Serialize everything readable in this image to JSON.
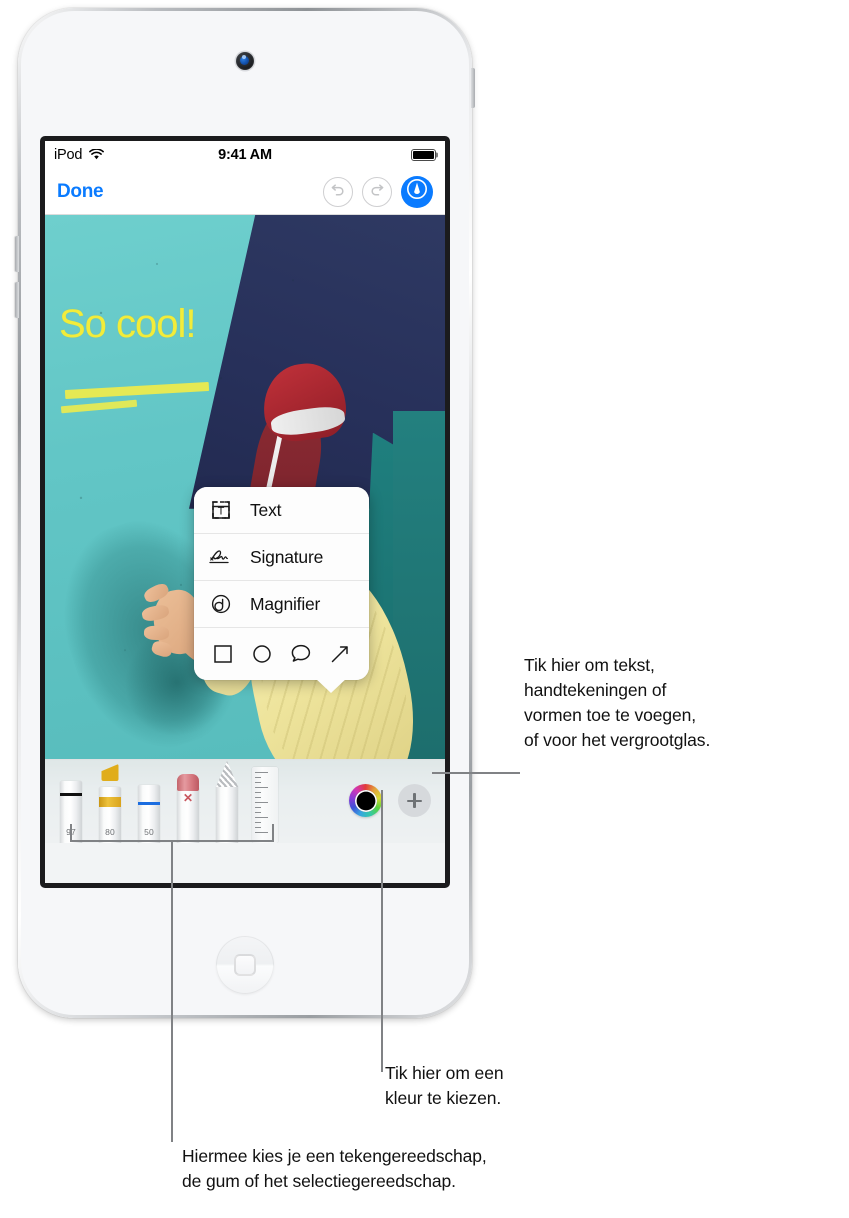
{
  "device": {
    "name": "iPod touch",
    "frame_color": "#f2f3f5"
  },
  "status_bar": {
    "carrier": "iPod",
    "wifi_icon": "wifi-icon",
    "time": "9:41 AM",
    "battery_icon": "battery-full-icon"
  },
  "nav_bar": {
    "done_label": "Done",
    "undo_icon": "undo-icon",
    "undo_enabled": false,
    "redo_icon": "redo-icon",
    "redo_enabled": false,
    "markup_icon": "markup-pen-icon",
    "markup_active": true,
    "accent_color": "#0a7bff"
  },
  "photo": {
    "annotation_text": "So cool!",
    "annotation_color": "#f2ec3a",
    "highlight_color": "#f0ec4a",
    "description": "Breakdancer in mid-move against teal and navy wall"
  },
  "popup_menu": {
    "items": [
      {
        "icon": "text-box-icon",
        "label": "Text"
      },
      {
        "icon": "signature-icon",
        "label": "Signature"
      },
      {
        "icon": "magnifier-icon",
        "label": "Magnifier"
      }
    ],
    "shapes": [
      {
        "icon": "square-shape-icon"
      },
      {
        "icon": "circle-shape-icon"
      },
      {
        "icon": "speech-bubble-shape-icon"
      },
      {
        "icon": "arrow-shape-icon"
      }
    ]
  },
  "toolbar": {
    "tools": [
      {
        "name": "pen-tool",
        "number": "97",
        "color": "#0f0f0f"
      },
      {
        "name": "highlighter-tool",
        "number": "80",
        "color": "#e0ad1b"
      },
      {
        "name": "pencil-tool",
        "number": "50",
        "color": "#1b6de0"
      },
      {
        "name": "eraser-tool",
        "number": "",
        "color": "#c8565e",
        "badge": "✕"
      },
      {
        "name": "lasso-tool",
        "number": "",
        "color": "#b9bcbf"
      },
      {
        "name": "ruler-tool",
        "number": "",
        "color": "#eceef0"
      }
    ],
    "color_picker": {
      "name": "color-wheel",
      "selected_color": "#000000"
    },
    "add_button": {
      "name": "add-annotation-button",
      "icon": "plus-icon"
    }
  },
  "callouts": [
    {
      "id": "callout-add",
      "lines": [
        "Tik hier om tekst,",
        "handtekeningen of",
        "vormen toe te voegen,",
        "of voor het vergrootglas."
      ]
    },
    {
      "id": "callout-color",
      "lines": [
        "Tik hier om een",
        "kleur te kiezen."
      ]
    },
    {
      "id": "callout-tools",
      "lines": [
        "Hiermee kies je een tekengereedschap,",
        "de gum of het selectiegereedschap."
      ]
    }
  ]
}
